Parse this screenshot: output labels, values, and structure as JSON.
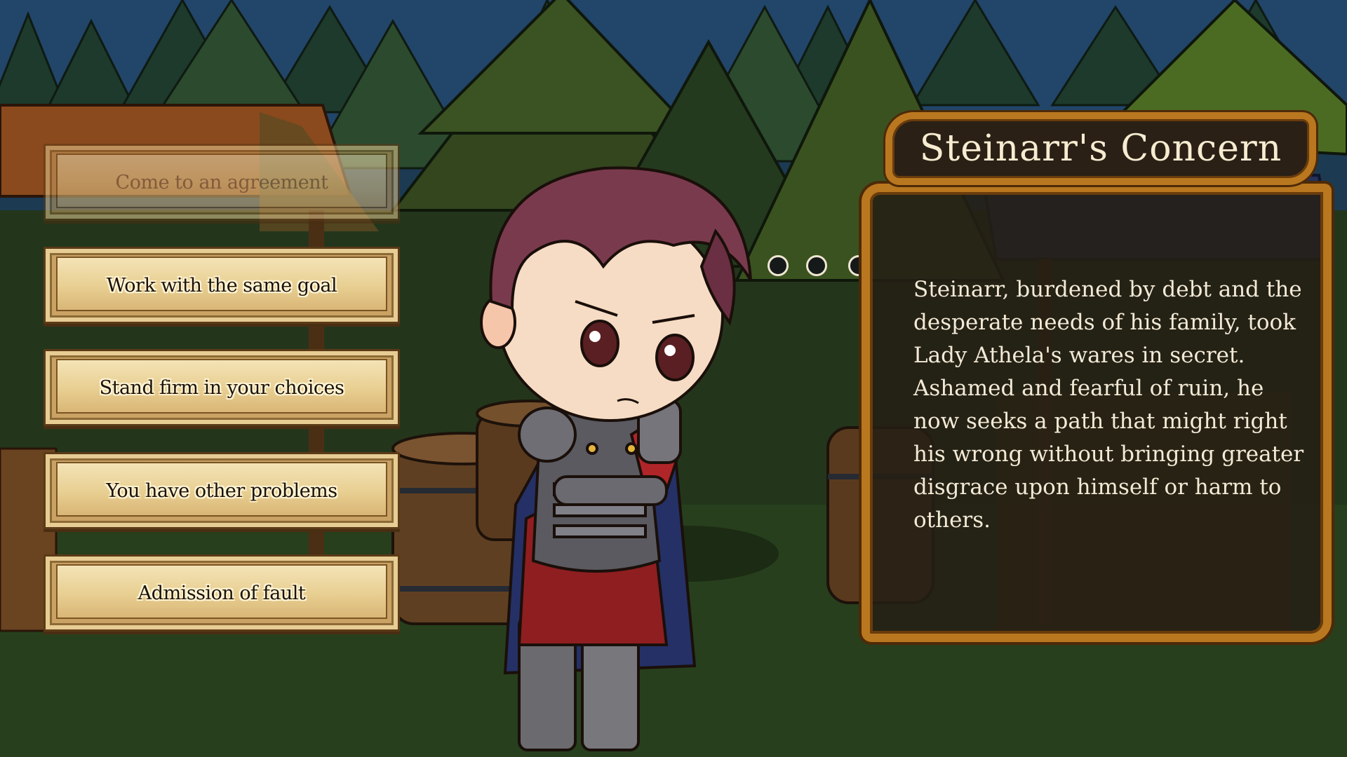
{
  "choices": [
    {
      "label": "Come to an agreement",
      "state": "disabled"
    },
    {
      "label": "Work with the same goal",
      "state": "enabled"
    },
    {
      "label": "Stand firm in your choices",
      "state": "enabled"
    },
    {
      "label": "You have other problems",
      "state": "enabled"
    },
    {
      "label": "Admission of fault",
      "state": "enabled"
    }
  ],
  "panel": {
    "title": "Steinarr's Concern",
    "description": "Steinarr, burdened by debt and the desperate needs of his family, took Lady Athela's wares in secret. Ashamed and fearful of ruin, he now seeks a path that might right his wrong without bringing greater disgrace upon himself or harm to others."
  },
  "colors": {
    "sky": "#1c3a52",
    "frame_gold": "#b9771f",
    "parchment": "#e8cf92",
    "panel_bg": "#241e14"
  },
  "icons": {
    "thought_bubble": "thought-bubble-dots-icon"
  }
}
